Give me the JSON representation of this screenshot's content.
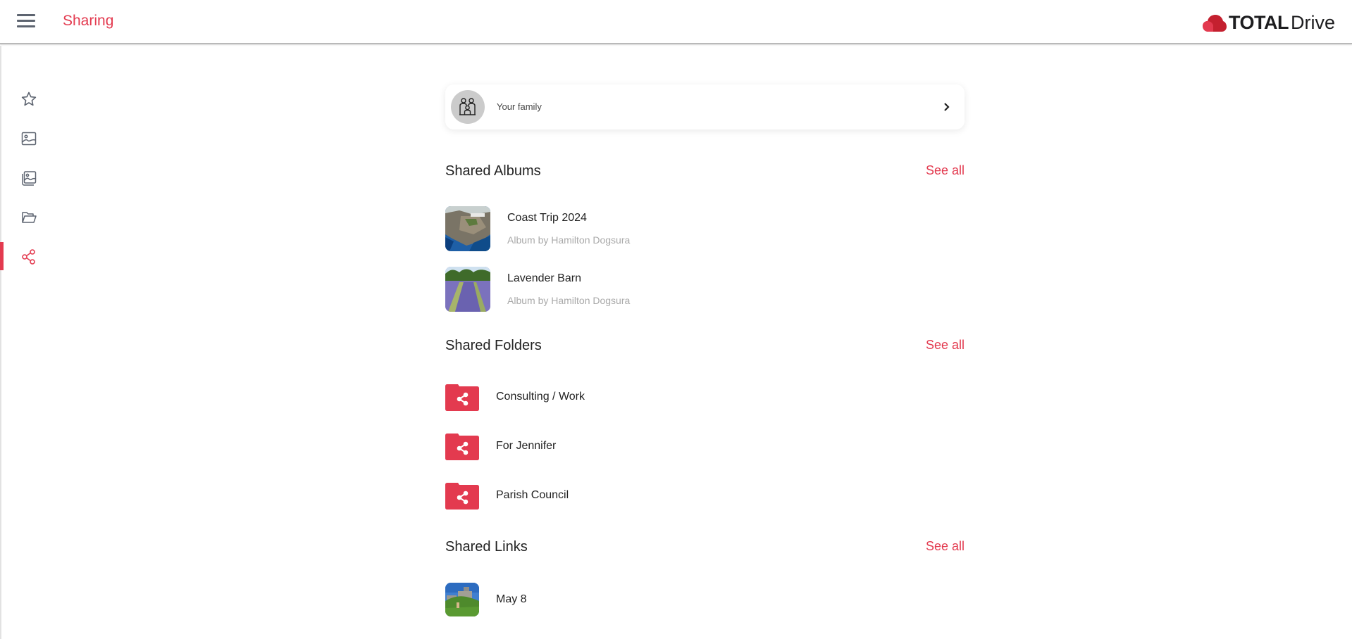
{
  "header": {
    "title": "Sharing",
    "brand_bold": "TOTAL",
    "brand_light": "Drive",
    "accent_color": "#e33a4f"
  },
  "sidebar": {
    "items": [
      {
        "name": "favorites",
        "icon": "star-icon",
        "active": false
      },
      {
        "name": "photos",
        "icon": "image-icon",
        "active": false
      },
      {
        "name": "albums",
        "icon": "images-icon",
        "active": false
      },
      {
        "name": "files",
        "icon": "folder-open-icon",
        "active": false
      },
      {
        "name": "sharing",
        "icon": "share-icon",
        "active": true
      }
    ]
  },
  "family": {
    "label": "Your family"
  },
  "shared_albums": {
    "title": "Shared Albums",
    "see_all": "See all",
    "items": [
      {
        "name": "Coast Trip 2024",
        "subtitle": "Album by Hamilton Dogsura",
        "thumb": "coastal-cliffs"
      },
      {
        "name": "Lavender Barn",
        "subtitle": "Album by Hamilton Dogsura",
        "thumb": "lavender-field"
      }
    ]
  },
  "shared_folders": {
    "title": "Shared Folders",
    "see_all": "See all",
    "items": [
      {
        "name": "Consulting / Work"
      },
      {
        "name": "For Jennifer"
      },
      {
        "name": "Parish Council"
      }
    ]
  },
  "shared_links": {
    "title": "Shared Links",
    "see_all": "See all",
    "items": [
      {
        "name": "May 8",
        "thumb": "castle-hill"
      }
    ]
  }
}
